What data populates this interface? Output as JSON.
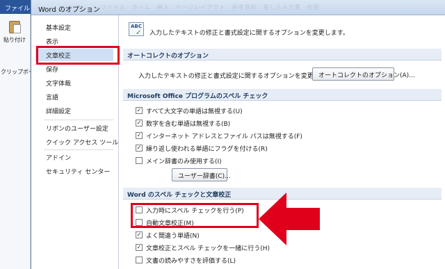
{
  "word": {
    "file_tab": "ファイル",
    "paste_label": "貼り付け",
    "clipboard_label": "クリップボー"
  },
  "dialog": {
    "title": "Word のオプション",
    "ghost_tabs": "ファイル　ホーム　挿入　ページレイアウト　参考資料　差し込み文書　校閲"
  },
  "nav": {
    "items": [
      {
        "label": "基本設定"
      },
      {
        "label": "表示"
      },
      {
        "label": "文章校正"
      },
      {
        "label": "保存"
      },
      {
        "label": "文字体裁"
      },
      {
        "label": "言語"
      },
      {
        "label": "詳細設定"
      },
      {
        "label": "リボンのユーザー設定"
      },
      {
        "label": "クイック アクセス ツール バー"
      },
      {
        "label": "アドイン"
      },
      {
        "label": "セキュリティ センター"
      }
    ],
    "selected": "文章校正"
  },
  "content": {
    "intro": "入力したテキストの修正と書式設定に関するオプションを変更します。",
    "autocorrect": {
      "header": "オートコレクトのオプション",
      "text": "入力したテキストの修正と書式設定に関するオプションを変更します。",
      "button": "オートコレクトのオプション(A)..."
    },
    "office_spell": {
      "header": "Microsoft Office プログラムのスペル チェック",
      "options": [
        {
          "label": "すべて大文字の単語は無視する(U)",
          "checked": true
        },
        {
          "label": "数字を含む単語は無視する(B)",
          "checked": true
        },
        {
          "label": "インターネット アドレスとファイル パスは無視する(F)",
          "checked": true
        },
        {
          "label": "繰り返し使われる単語にフラグを付ける(R)",
          "checked": true
        },
        {
          "label": "メイン辞書のみ使用する(I)",
          "checked": false
        }
      ],
      "dict_button": "ユーザー辞書(C)..."
    },
    "word_spell": {
      "header": "Word のスペル チェックと文章校正",
      "options": [
        {
          "label": "入力時にスペル チェックを行う(P)",
          "checked": false
        },
        {
          "label": "自動文章校正(M)",
          "checked": false
        },
        {
          "label": "よく間違う単語(N)",
          "checked": true
        },
        {
          "label": "文章校正とスペル チェックを一緒に行う(H)",
          "checked": true
        },
        {
          "label": "文書の読みやすさを評価する(L)",
          "checked": false
        }
      ]
    }
  },
  "colors": {
    "annotation_red": "#e0001b",
    "selection_blue": "#cfe0f5",
    "file_tab_blue": "#2a5699"
  }
}
